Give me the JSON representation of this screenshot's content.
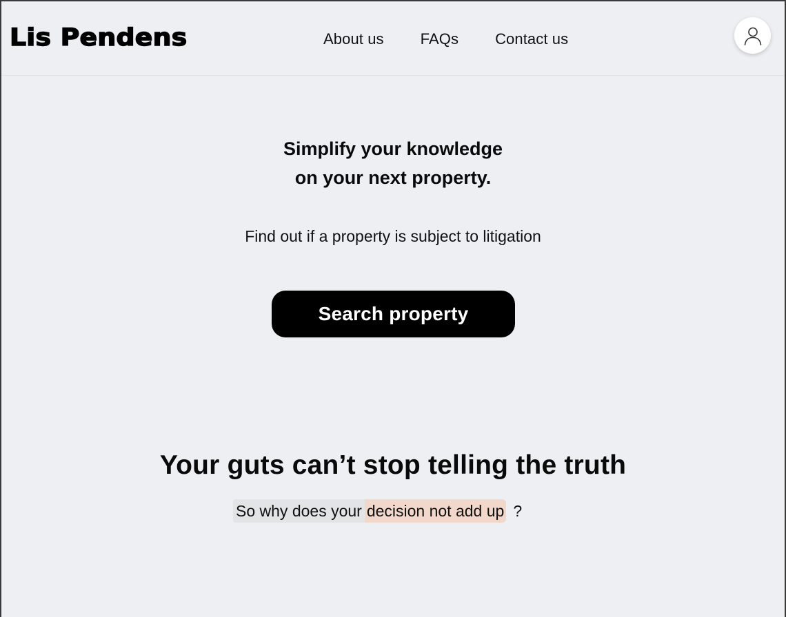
{
  "header": {
    "logo": "Lis Pendens",
    "nav": [
      {
        "label": "About us"
      },
      {
        "label": "FAQs"
      },
      {
        "label": "Contact us"
      }
    ],
    "avatar_icon": "user-icon"
  },
  "hero": {
    "title_line1": "Simplify your knowledge",
    "title_line2": "on your next property.",
    "subtitle": "Find out if a property is subject to litigation",
    "search_button": "Search property"
  },
  "section": {
    "title": "Your guts can’t stop telling the truth",
    "question_part1": "So why does your",
    "question_part2": "decision not add up",
    "question_mark": "?"
  },
  "colors": {
    "background": "#eeeff3",
    "button": "#000000",
    "highlight_gray": "#e3e4e6",
    "highlight_peach": "#f1d8cb"
  }
}
